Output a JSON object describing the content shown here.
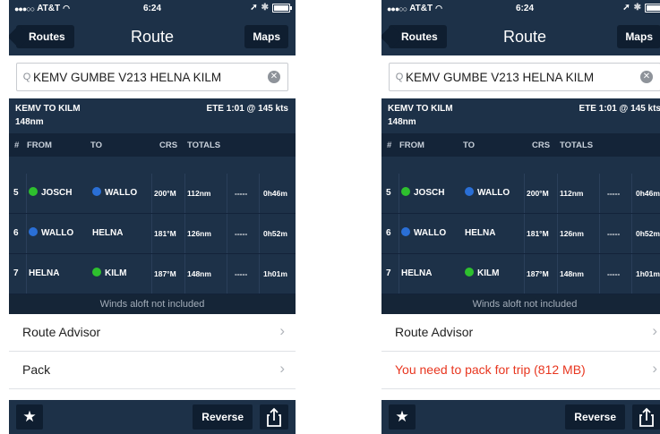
{
  "status": {
    "carrier": "AT&T",
    "time": "6:24"
  },
  "nav": {
    "back_label": "Routes",
    "title": "Route",
    "maps_label": "Maps"
  },
  "search": {
    "value": "KEMV GUMBE V213 HELNA KILM"
  },
  "summary": {
    "route_name": "KEMV TO KILM",
    "distance": "148nm",
    "ete": "ETE 1:01 @ 145 kts"
  },
  "table": {
    "headers": {
      "num": "#",
      "from": "FROM",
      "to": "TO",
      "crs": "CRS",
      "totals": "TOTALS"
    },
    "rows": [
      {
        "num": "5",
        "from": "JOSCH",
        "from_dot": "green",
        "to": "WALLO",
        "to_dot": "blue",
        "crs": "200°M",
        "dist": "112nm",
        "dash": "-----",
        "time": "0h46m"
      },
      {
        "num": "6",
        "from": "WALLO",
        "from_dot": "blue",
        "to": "HELNA",
        "to_dot": "",
        "crs": "181°M",
        "dist": "126nm",
        "dash": "-----",
        "time": "0h52m"
      },
      {
        "num": "7",
        "from": "HELNA",
        "from_dot": "",
        "to": "KILM",
        "to_dot": "green",
        "crs": "187°M",
        "dist": "148nm",
        "dash": "-----",
        "time": "1h01m"
      }
    ]
  },
  "winds_note": "Winds aloft not included",
  "list": {
    "route_advisor": "Route Advisor",
    "pack_a": "Pack",
    "pack_b": "You need to pack for trip (812 MB)"
  },
  "toolbar": {
    "star_icon": "star-icon",
    "reverse_label": "Reverse",
    "share_icon": "share-icon"
  },
  "colors": {
    "navy": "#1d3148",
    "dark_button": "#0f1e30",
    "green_dot": "#2ec02e",
    "blue_dot": "#2a6fd6",
    "warning": "#e8361f"
  }
}
